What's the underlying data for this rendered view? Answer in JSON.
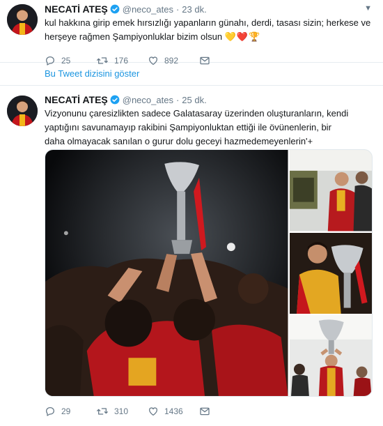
{
  "colors": {
    "accent": "#1da1f2",
    "link": "#1b95e0",
    "muted": "#657786",
    "heart": "#e0245e"
  },
  "tweets": [
    {
      "author_name": "NECATİ ATEŞ",
      "handle": "@neco_ates",
      "separator": "·",
      "time": "23 dk.",
      "text": "kul hakkına girip emek hırsızlığı yapanların günahı, derdi, tasası sizin; herkese ve herşeye rağmen Şampiyonluklar bizim olsun",
      "emoji": "💛❤️🏆",
      "replies": "25",
      "retweets": "176",
      "likes": "892",
      "icons": [
        "reply-icon",
        "retweet-icon",
        "like-icon",
        "message-icon"
      ]
    },
    {
      "author_name": "NECATİ ATEŞ",
      "handle": "@neco_ates",
      "separator": "·",
      "time": "25 dk.",
      "text": "Vizyonunu çaresizlikten sadece Galatasaray üzerinden oluşturanların, kendi yaptığını savunamayıp rakibini Şampiyonluktan ettiği ile övünenlerin, bir daha olmayacak sanılan o gurur dolu geceyi hazmedemeyenlerin'+",
      "replies": "29",
      "retweets": "310",
      "likes": "1436",
      "icons": [
        "reply-icon",
        "retweet-icon",
        "like-icon",
        "message-icon"
      ]
    }
  ],
  "thread_link": "Bu Tweet dizisini göster"
}
